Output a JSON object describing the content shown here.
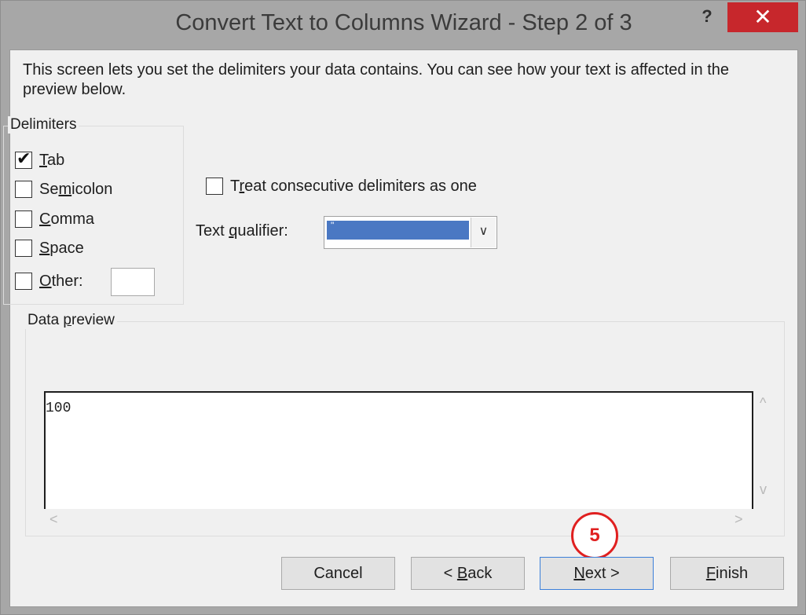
{
  "window": {
    "title": "Convert Text to Columns Wizard - Step 2 of 3",
    "help_glyph": "?",
    "close_glyph": "✕"
  },
  "intro_text": "This screen lets you set the delimiters your data contains.  You can see how your text is affected in the preview below.",
  "delimiters": {
    "label": "Delimiters",
    "items": [
      {
        "label": "Tab",
        "accel": "T",
        "rest": "ab",
        "checked": true
      },
      {
        "label": "Semicolon",
        "pre": "Se",
        "accel": "m",
        "rest": "icolon",
        "checked": false
      },
      {
        "label": "Comma",
        "accel": "C",
        "rest": "omma",
        "checked": false
      },
      {
        "label": "Space",
        "accel": "S",
        "rest": "pace",
        "checked": false
      },
      {
        "label": "Other:",
        "accel": "O",
        "rest": "ther:",
        "checked": false
      }
    ],
    "other_value": ""
  },
  "options": {
    "consecutive": {
      "label": "Treat consecutive delimiters as one",
      "pre": "T",
      "accel": "r",
      "rest": "eat consecutive delimiters as one",
      "checked": false
    },
    "qualifier": {
      "label": "Text qualifier:",
      "pre": "Text ",
      "accel": "q",
      "rest": "ualifier:",
      "value": "\""
    }
  },
  "preview": {
    "label": "Data preview",
    "pre": "Data ",
    "accel": "p",
    "rest": "review",
    "lines": [
      "100"
    ]
  },
  "scroll_glyphs": {
    "up": "^",
    "down": "v",
    "left": "<",
    "right": ">"
  },
  "buttons": {
    "cancel": "Cancel",
    "back": {
      "label": "< Back",
      "pre": "< ",
      "accel": "B",
      "rest": "ack"
    },
    "next": {
      "label": "Next >",
      "accel": "N",
      "rest": "ext >"
    },
    "finish": {
      "label": "Finish",
      "accel": "F",
      "rest": "inish"
    }
  },
  "step_marker": "5",
  "colors": {
    "close": "#c7272c",
    "selection": "#4a78c3",
    "marker": "#e02020",
    "client_bg": "#f0f0f0"
  }
}
